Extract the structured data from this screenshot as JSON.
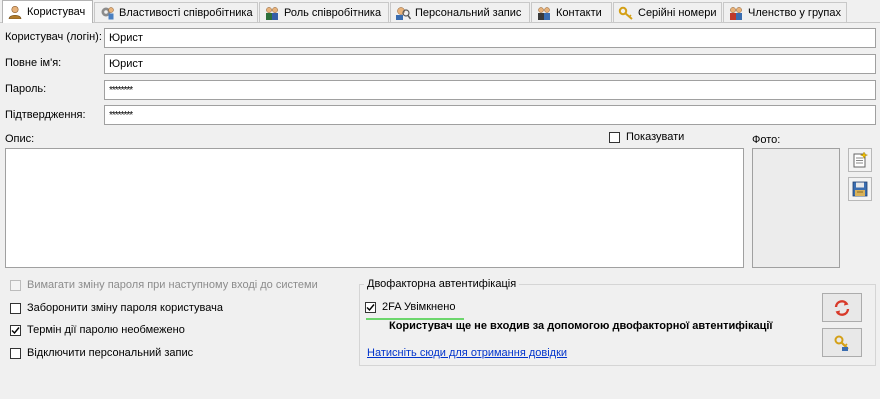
{
  "tabs": [
    {
      "label": "Користувач",
      "icon": "user-icon",
      "active": true
    },
    {
      "label": "Властивості співробітника",
      "icon": "employee-properties-icon",
      "active": false
    },
    {
      "label": "Роль співробітника",
      "icon": "role-icon",
      "active": false
    },
    {
      "label": "Персональний запис",
      "icon": "personal-record-icon",
      "active": false
    },
    {
      "label": "Контакти",
      "icon": "contacts-icon",
      "active": false
    },
    {
      "label": "Серійні номери",
      "icon": "key-icon",
      "active": false
    },
    {
      "label": "Членство у групах",
      "icon": "group-icon",
      "active": false
    }
  ],
  "form": {
    "login_label": "Користувач (логін):",
    "login_value": "Юрист",
    "fullname_label": "Повне ім'я:",
    "fullname_value": "Юрист",
    "password_label": "Пароль:",
    "password_value": "********",
    "confirm_label": "Підтвердження:",
    "confirm_value": "********",
    "description_label": "Опис:",
    "show_label": "Показувати",
    "show_checked": false,
    "photo_label": "Фото:"
  },
  "options": {
    "require_change": {
      "label": "Вимагати зміну пароля при наступному вході до системи",
      "checked": false,
      "disabled": true
    },
    "forbid_change": {
      "label": "Заборонити зміну пароля користувача",
      "checked": false
    },
    "no_expiry": {
      "label": "Термін дії паролю необмежено",
      "checked": true
    },
    "disable_record": {
      "label": "Відключити персональний запис",
      "checked": false
    }
  },
  "twofa": {
    "group_title": "Двофакторна автентифікація",
    "enabled_label": "2FA Увімкнено",
    "enabled_checked": true,
    "status_text": "Користувач ще не входив за допомогою двофакторної автентифікації",
    "help_link": "Натисніть сюди для отримання довідки"
  },
  "colors": {
    "accent_green": "#6cd66c",
    "link_blue": "#0033cc"
  }
}
